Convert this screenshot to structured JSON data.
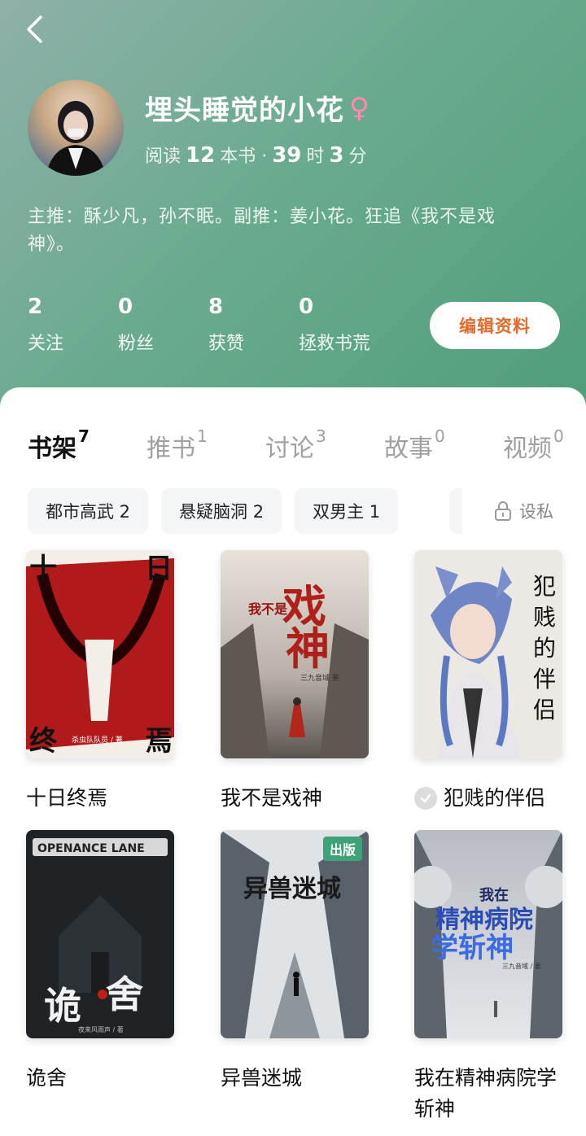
{
  "profile": {
    "name": "埋头睡觉的小花",
    "gender_icon": "♀",
    "reading_prefix": "阅读",
    "books_count": "12",
    "books_unit": "本书 ·",
    "hours": "39",
    "hours_unit": "时",
    "minutes": "3",
    "minutes_unit": "分",
    "bio": "主推：酥少凡，孙不眠。副推：姜小花。狂追《我不是戏神》。"
  },
  "stats": [
    {
      "value": "2",
      "label": "关注"
    },
    {
      "value": "0",
      "label": "粉丝"
    },
    {
      "value": "8",
      "label": "获赞"
    },
    {
      "value": "0",
      "label": "拯救书荒"
    }
  ],
  "edit_button": "编辑资料",
  "tabs": [
    {
      "label": "书架",
      "count": "7"
    },
    {
      "label": "推书",
      "count": "1"
    },
    {
      "label": "讨论",
      "count": "3"
    },
    {
      "label": "故事",
      "count": "0"
    },
    {
      "label": "视频",
      "count": "0"
    }
  ],
  "chips": [
    "都市高武 2",
    "悬疑脑洞 2",
    "双男主 1"
  ],
  "privacy_label": "设私",
  "books": [
    {
      "title": "十日终焉",
      "cover_text": [
        "十",
        "日",
        "终",
        "焉"
      ],
      "cover_author": "杀虫队队员 / 著"
    },
    {
      "title": "我不是戏神",
      "cover_text": [
        "我不是",
        "戏",
        "神"
      ],
      "cover_author": "三九音域 著"
    },
    {
      "title": "犯贱的伴侣",
      "cover_text": [
        "犯",
        "贱",
        "的",
        "伴",
        "侣"
      ]
    },
    {
      "title": "诡舍",
      "cover_text": [
        "OPENANCE LANE",
        "诡",
        "舍"
      ],
      "cover_author": "夜来风雨声 / 著"
    },
    {
      "title": "异兽迷城",
      "cover_text": [
        "异兽迷城"
      ],
      "badge": "出版"
    },
    {
      "title": "我在精神病院学斩神",
      "cover_text": [
        "我在",
        "精神病院",
        "学斩神"
      ],
      "cover_author": "三九音域 / 著"
    }
  ],
  "colors": {
    "header_gradient_start": "#8fb0a8",
    "header_gradient_end": "#4f9e78",
    "edit_button_text": "#e46a2c",
    "gender_icon": "#ff8ab1",
    "publish_badge": "#3fa37a"
  }
}
